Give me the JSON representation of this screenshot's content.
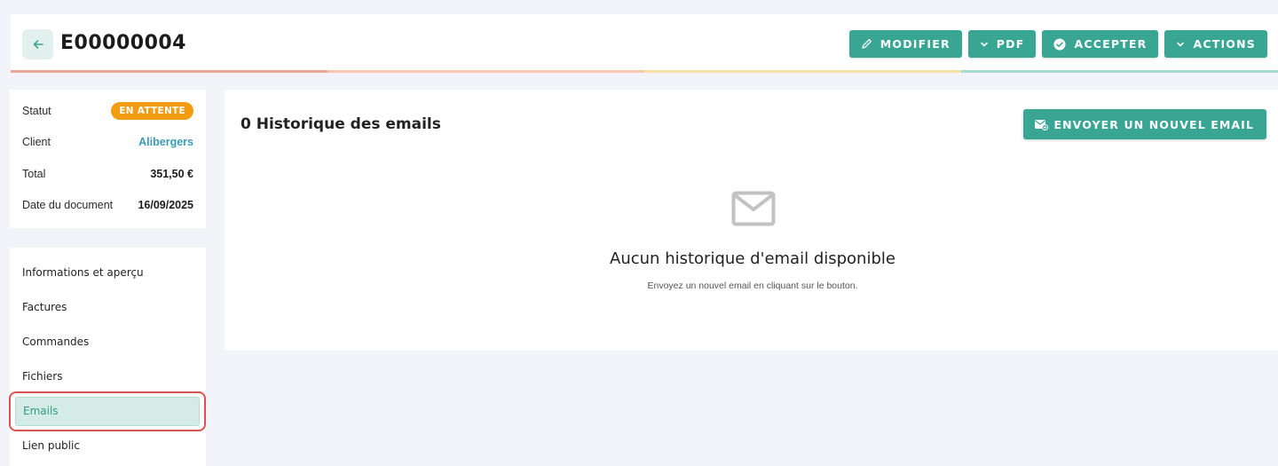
{
  "header": {
    "title": "E00000004",
    "actions": {
      "modify": "MODIFIER",
      "pdf": "PDF",
      "accept": "ACCEPTER",
      "actions": "ACTIONS"
    },
    "stripe_colors": [
      "#f0a59a",
      "#f7c7ad",
      "#f8dfa3",
      "#a6dccf"
    ]
  },
  "info": {
    "status_label": "Statut",
    "status_value": "EN ATTENTE",
    "client_label": "Client",
    "client_value": "Alibergers",
    "total_label": "Total",
    "total_value": "351,50 €",
    "date_label": "Date du document",
    "date_value": "16/09/2025"
  },
  "nav": {
    "items": [
      {
        "label": "Informations et aperçu"
      },
      {
        "label": "Factures"
      },
      {
        "label": "Commandes"
      },
      {
        "label": "Fichiers"
      },
      {
        "label": "Emails"
      },
      {
        "label": "Lien public"
      }
    ],
    "active_index": 4
  },
  "main": {
    "title": "0 Historique des emails",
    "send_button": "ENVOYER UN NOUVEL EMAIL",
    "empty_title": "Aucun historique d'email disponible",
    "empty_subtitle": "Envoyez un nouvel email en cliquant sur le bouton."
  },
  "colors": {
    "accent": "#38a693",
    "status_pending": "#f39c12",
    "link": "#3a9bb5",
    "highlight_outline": "#d9534f"
  },
  "icons": {
    "back": "arrow-left-icon",
    "modify": "pencil-icon",
    "pdf": "chevron-down-icon",
    "accept": "check-circle-icon",
    "actions": "chevron-down-icon",
    "send": "mail-plus-icon",
    "empty": "envelope-icon"
  }
}
